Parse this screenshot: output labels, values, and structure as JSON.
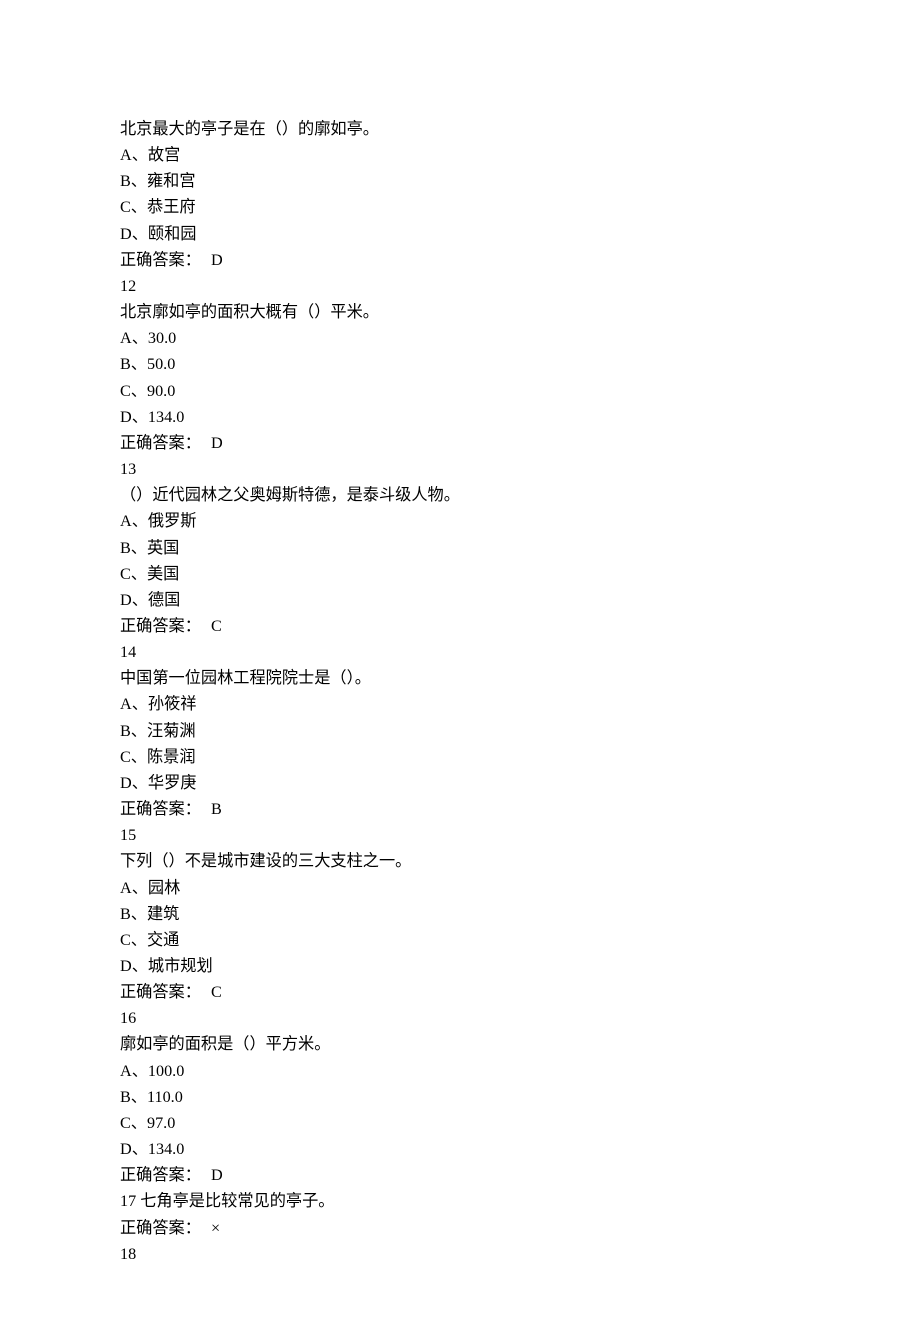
{
  "q11": {
    "stem": "北京最大的亭子是在（）的廓如亭。",
    "A": "A、故宫",
    "B": "B、雍和宫",
    "C": "C、恭王府",
    "D": "D、颐和园",
    "ansLabel": "正确答案：",
    "ansValue": "D"
  },
  "n12": "12",
  "q12": {
    "stem": "北京廓如亭的面积大概有（）平米。",
    "A": "A、30.0",
    "B": "B、50.0",
    "C": "C、90.0",
    "D": "D、134.0",
    "ansLabel": "正确答案：",
    "ansValue": "D"
  },
  "n13": "13",
  "q13": {
    "stem": "（）近代园林之父奥姆斯特德，是泰斗级人物。",
    "A": "A、俄罗斯",
    "B": "B、英国",
    "C": "C、美国",
    "D": "D、德国",
    "ansLabel": "正确答案：",
    "ansValue": "C"
  },
  "n14": "14",
  "q14": {
    "stem": "中国第一位园林工程院院士是（）。",
    "A": "A、孙筱祥",
    "B": "B、汪菊渊",
    "C": "C、陈景润",
    "D": "D、华罗庚",
    "ansLabel": "正确答案：",
    "ansValue": "B"
  },
  "n15": "15",
  "q15": {
    "stem": "下列（）不是城市建设的三大支柱之一。",
    "A": "A、园林",
    "B": "B、建筑",
    "C": "C、交通",
    "D": "D、城市规划",
    "ansLabel": "正确答案：",
    "ansValue": "C"
  },
  "n16": "16",
  "q16": {
    "stem": "廓如亭的面积是（）平方米。",
    "A": "A、100.0",
    "B": "B、110.0",
    "C": "C、97.0",
    "D": "D、134.0",
    "ansLabel": "正确答案：",
    "ansValue": "D"
  },
  "q17": {
    "stem": "17 七角亭是比较常见的亭子。",
    "ansLabel": "正确答案：",
    "ansValue": "×"
  },
  "n18": "18"
}
